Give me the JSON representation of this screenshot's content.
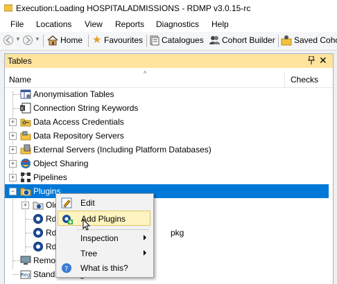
{
  "window": {
    "title": "Execution:Loading HOSPITALADMISSIONS - RDMP v3.0.15-rc"
  },
  "menu": [
    "File",
    "Locations",
    "View",
    "Reports",
    "Diagnostics",
    "Help"
  ],
  "toolbar": {
    "home": "Home",
    "favourites": "Favourites",
    "catalogues": "Catalogues",
    "cohort_builder": "Cohort Builder",
    "saved_cohorts": "Saved Coho"
  },
  "panel": {
    "title": "Tables",
    "pin": "📌",
    "close": "✕",
    "col_name": "Name",
    "col_checks": "Checks",
    "sort_glyph": "^"
  },
  "tree": [
    {
      "label": "Anonymisation Tables",
      "icon": "table-icon",
      "expander": ""
    },
    {
      "label": "Connection String Keywords",
      "icon": "keyword-icon",
      "expander": ""
    },
    {
      "label": "Data Access Credentials",
      "icon": "key-folder-icon",
      "expander": "+"
    },
    {
      "label": "Data Repository Servers",
      "icon": "folder-icon",
      "expander": "+"
    },
    {
      "label": "External Servers (Including Platform Databases)",
      "icon": "server-icon",
      "expander": "+"
    },
    {
      "label": "Object Sharing",
      "icon": "share-icon",
      "expander": "+"
    },
    {
      "label": "Pipelines",
      "icon": "pipeline-icon",
      "expander": "+"
    },
    {
      "label": "Plugins",
      "icon": "plugin-icon",
      "expander": "−",
      "selected": true
    },
    {
      "label": "Old",
      "icon": "plugin-folder-icon",
      "expander": "+",
      "child": true
    },
    {
      "label": "Rd",
      "icon": "plugin-package-icon",
      "expander": "",
      "child": true
    },
    {
      "label": "Rd",
      "icon": "plugin-package-icon",
      "expander": "",
      "child": true,
      "suffix": "pkg"
    },
    {
      "label": "Rd",
      "icon": "plugin-package-icon",
      "expander": "",
      "child": true
    },
    {
      "label": "Remot",
      "icon": "remote-icon",
      "expander": ""
    },
    {
      "label": "Standard Regexes",
      "icon": "regex-icon",
      "expander": ""
    }
  ],
  "context_menu": {
    "items": [
      {
        "label": "Edit",
        "icon": "edit-icon"
      },
      {
        "label": "Add Plugins",
        "icon": "add-plugins-icon"
      },
      {
        "label": "Inspection",
        "submenu": true
      },
      {
        "label": "Tree",
        "submenu": true
      },
      {
        "label": "What is this?",
        "icon": "help-icon"
      }
    ]
  },
  "colors": {
    "selection": "#0078d7",
    "panel_header": "#ffe49e",
    "menu_hover": "#fdf4bf"
  }
}
